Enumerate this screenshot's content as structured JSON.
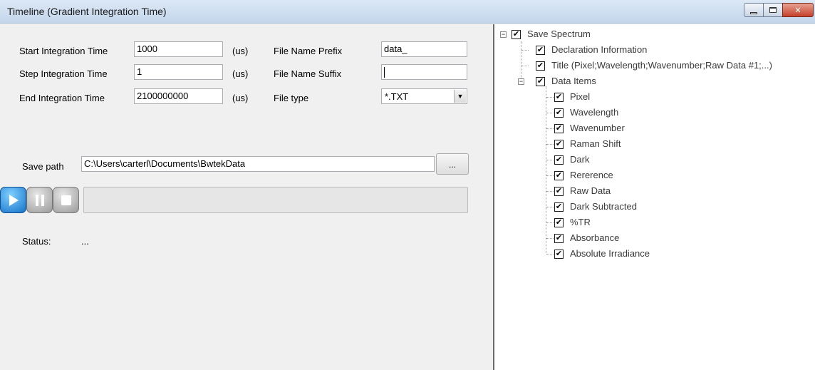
{
  "window": {
    "title": "Timeline (Gradient Integration Time)",
    "minimize_glyph": "minimize-icon",
    "maximize_glyph": "maximize-icon",
    "close_glyph": "✕"
  },
  "form": {
    "start_label": "Start Integration Time",
    "start_value": "1000",
    "start_unit": "(us)",
    "step_label": "Step Integration Time",
    "step_value": "1",
    "step_unit": "(us)",
    "end_label": "End Integration Time",
    "end_value": "2100000000",
    "end_unit": "(us)",
    "prefix_label": "File Name Prefix",
    "prefix_value": "data_",
    "suffix_label": "File Name Suffix",
    "suffix_value": "",
    "filetype_label": "File type",
    "filetype_value": "*.TXT",
    "savepath_label": "Save path",
    "savepath_value": "C:\\Users\\carterl\\Documents\\BwtekData",
    "browse_label": "...",
    "status_label": "Status:",
    "status_value": "..."
  },
  "controls": {
    "play_icon": "play-icon",
    "pause_icon": "pause-icon",
    "stop_icon": "stop-icon",
    "play_color": "#1873c9"
  },
  "tree": {
    "root": "Save Spectrum",
    "declaration": "Declaration Information",
    "title_item": "Title   (Pixel;Wavelength;Wavenumber;Raw Data #1;...)",
    "data_items": "Data Items",
    "items": [
      "Pixel",
      "Wavelength",
      "Wavenumber",
      "Raman Shift",
      "Dark",
      "Rererence",
      "Raw Data",
      "Dark Subtracted",
      "%TR",
      "Absorbance",
      "Absolute Irradiance"
    ],
    "check_glyph": "✔",
    "collapse_glyph": "−"
  }
}
